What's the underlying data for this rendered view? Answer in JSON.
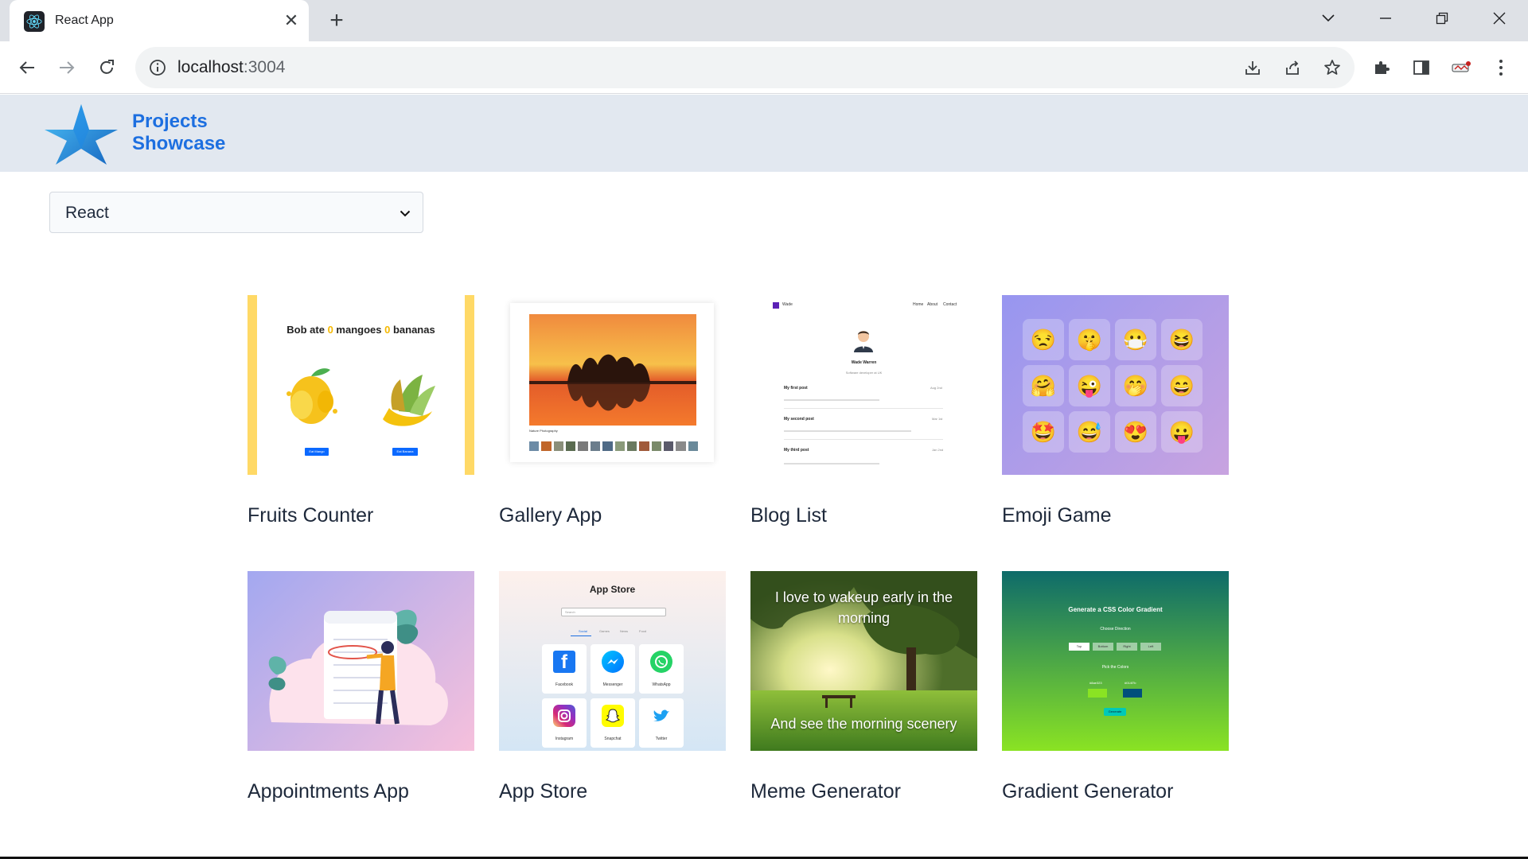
{
  "browser": {
    "tab_title": "React App",
    "url_host": "localhost",
    "url_port": ":3004"
  },
  "header": {
    "brand_line1": "Projects",
    "brand_line2": "Showcase"
  },
  "filter": {
    "selected": "React"
  },
  "projects": [
    {
      "title": "Fruits Counter"
    },
    {
      "title": "Gallery App"
    },
    {
      "title": "Blog List"
    },
    {
      "title": "Emoji Game"
    },
    {
      "title": "Appointments App"
    },
    {
      "title": "App Store"
    },
    {
      "title": "Meme Generator"
    },
    {
      "title": "Gradient Generator"
    }
  ],
  "thumbs": {
    "fruits": {
      "headline_a": "Bob ate ",
      "count1": "0",
      "headline_b": " mangoes ",
      "count2": "0",
      "headline_c": " bananas",
      "btn1": "Eat Mango",
      "btn2": "Eat Banana"
    },
    "gallery": {
      "caption": "Nature Photography"
    },
    "blog": {
      "brand": "Wade",
      "nav": [
        "Home",
        "About",
        "Contact"
      ],
      "author": "Wade Warren",
      "role": "Software developer at UK",
      "posts": [
        {
          "title": "My first post",
          "date": "Aug 2nd"
        },
        {
          "title": "My second post",
          "date": "Mar 1st"
        },
        {
          "title": "My third post",
          "date": "Jan 2nd"
        }
      ]
    },
    "appstore": {
      "heading": "App Store",
      "search": "Search",
      "tabs": [
        "Social",
        "Games",
        "News",
        "Food"
      ],
      "apps": [
        "Facebook",
        "Messenger",
        "WhatsApp",
        "Instagram",
        "Snapchat",
        "Twitter"
      ]
    },
    "meme": {
      "top": "I love to  wakeup  early in the morning",
      "bottom": "And see the morning scenery"
    },
    "gradient": {
      "heading": "Generate a CSS Color Gradient",
      "direction_label": "Choose Direction",
      "directions": [
        "Top",
        "Bottom",
        "Right",
        "Left"
      ],
      "pick_label": "Pick the Colors",
      "color1": "#8ae323",
      "color2": "#014f7b",
      "generate": "Generate"
    }
  },
  "colors": {
    "brand": "#1d6fe0",
    "header_bg": "#e2e8f0"
  }
}
